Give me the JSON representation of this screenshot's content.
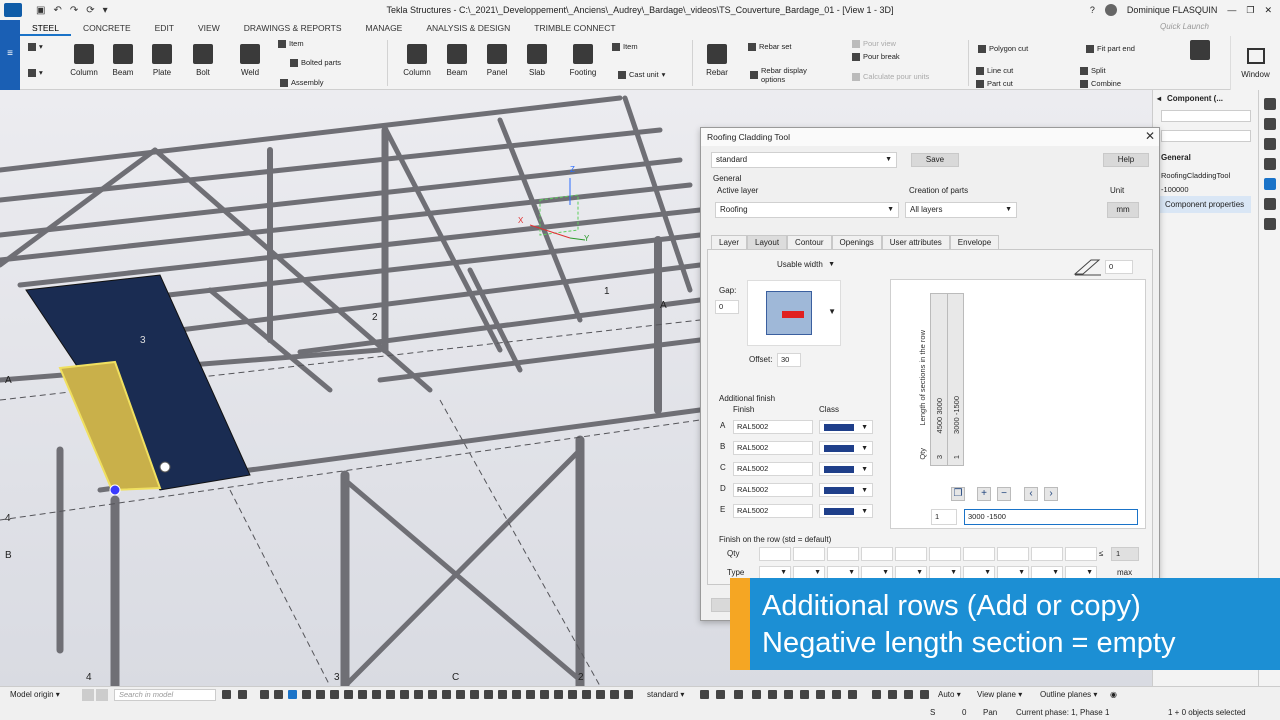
{
  "titlebar": {
    "title": "Tekla Structures - C:\\_2021\\_Developpement\\_Anciens\\_Audrey\\_Bardage\\_videos\\TS_Couverture_Bardage_01 - [View 1 - 3D]",
    "user": "Dominique FLASQUIN",
    "quick_launch": "Quick Launch"
  },
  "menu": [
    "STEEL",
    "CONCRETE",
    "EDIT",
    "VIEW",
    "DRAWINGS & REPORTS",
    "MANAGE",
    "ANALYSIS & DESIGN",
    "TRIMBLE CONNECT"
  ],
  "ribbon": {
    "steel": [
      "Column",
      "Beam",
      "Plate",
      "Bolt",
      "Weld"
    ],
    "steel_small": [
      "Item",
      "Bolted parts",
      "Assembly"
    ],
    "concrete": [
      "Column",
      "Beam",
      "Panel",
      "Slab",
      "Footing"
    ],
    "concrete_small": [
      "Item",
      "Cast unit"
    ],
    "rebar": "Rebar",
    "rebar_small": [
      "Rebar set",
      "Rebar display options"
    ],
    "pour_small": [
      "Pour view",
      "Pour break",
      "Calculate pour units"
    ],
    "edit_small": [
      "Polygon cut",
      "Line cut",
      "Part cut",
      "Fit part end",
      "Split",
      "Combine"
    ],
    "window": "Window"
  },
  "viewport": {
    "grid_labels": [
      "1",
      "2",
      "3",
      "A",
      "A",
      "B",
      "4",
      "4",
      "3",
      "C",
      "2"
    ],
    "axis_labels": [
      "Z",
      "X",
      "Y"
    ]
  },
  "sidepanel": {
    "title": "Component (...",
    "section": "General",
    "items": [
      "RoofingCladdingTool",
      "-100000"
    ],
    "button": "Component properties"
  },
  "dialog": {
    "title": "Roofing Cladding Tool",
    "preset": "standard",
    "save": "Save",
    "help": "Help",
    "general": "General",
    "active_layer_label": "Active layer",
    "active_layer": "Roofing",
    "creation_label": "Creation of parts",
    "creation": "All layers",
    "unit_label": "Unit",
    "unit": "mm",
    "tabs": [
      "Layer",
      "Layout",
      "Contour",
      "Openings",
      "User attributes",
      "Envelope"
    ],
    "width_mode": "Usable width",
    "gap_label": "Gap:",
    "gap": "0",
    "offset_label": "Offset:",
    "offset": "30",
    "angle_value": "0",
    "additional_finish": "Additional finish",
    "finish_header": "Finish",
    "class_header": "Class",
    "finishes": [
      {
        "letter": "A",
        "value": "RAL5002"
      },
      {
        "letter": "B",
        "value": "RAL5002"
      },
      {
        "letter": "C",
        "value": "RAL5002"
      },
      {
        "letter": "D",
        "value": "RAL5002"
      },
      {
        "letter": "E",
        "value": "RAL5002"
      }
    ],
    "rows_axis_label": "Length of sections in the row",
    "qty_label": "Qty",
    "row1_lengths": "4500 3000",
    "row1_qty": "3",
    "row2_lengths": "3000 -1500",
    "row2_qty": "1",
    "row_index": "1",
    "row_value": "3000 -1500",
    "finish_row_title": "Finish on the row (std = default)",
    "qty": "Qty",
    "type": "Type",
    "le_value": "1",
    "max": "max"
  },
  "caption": {
    "line1": "Additional rows (Add or copy)",
    "line2": "Negative length section = empty"
  },
  "statusbar": {
    "origin": "Model origin",
    "search": "Search in model",
    "standard": "standard",
    "auto": "Auto",
    "view_plane": "View plane",
    "outline_planes": "Outline planes",
    "s_label": "S",
    "s_value": "0",
    "pan": "Pan",
    "phase": "Current phase: 1, Phase 1",
    "selected": "1 + 0 objects selected"
  },
  "colors": {
    "accent": "#1a73c8",
    "caption_bg": "#1c8fd4",
    "caption_bar": "#f5a623",
    "sheet_blue": "#1a2c52",
    "sheet_yellow": "#c9b04a",
    "class_blue": "#1f3f8a"
  }
}
